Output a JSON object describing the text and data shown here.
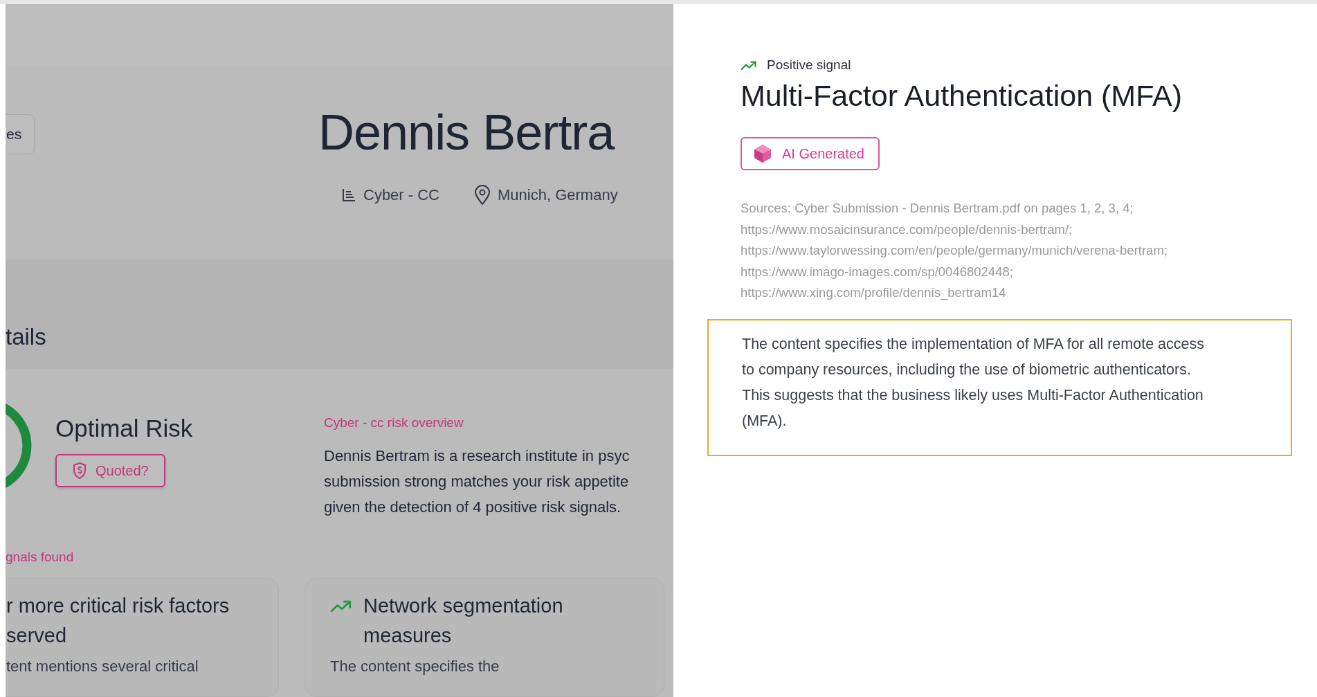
{
  "backdrop": {
    "header_button": "es",
    "profile": {
      "name": "Dennis Bertra",
      "line_of_business": "Cyber - CC",
      "location": "Munich, Germany"
    },
    "section_title": "tails",
    "risk": {
      "label": "Optimal Risk",
      "quote_button": "Quoted?"
    },
    "overview": {
      "title": "Cyber - cc risk overview",
      "lines": [
        "Dennis Bertram is a research institute in psyc",
        "submission strong matches your risk appetite",
        "given the detection of 4 positive risk signals."
      ]
    },
    "signals_label": "gnals found",
    "signal_cards": [
      {
        "kind": "neutral",
        "title_lines": [
          "r more critical risk factors",
          "served"
        ],
        "description": "tent mentions several critical"
      },
      {
        "kind": "positive",
        "title_lines": [
          "Network segmentation",
          "measures"
        ],
        "description": "The content specifies the"
      }
    ]
  },
  "detail_panel": {
    "signal_type": "Positive signal",
    "title": "Multi-Factor Authentication (MFA)",
    "badge": "AI Generated",
    "sources": [
      "Sources: Cyber Submission - Dennis Bertram.pdf on pages 1, 2, 3, 4;",
      "https://www.mosaicinsurance.com/people/dennis-bertram/;",
      "https://www.taylorwessing.com/en/people/germany/munich/verena-bertram;",
      "https://www.imago-images.com/sp/0046802448;",
      "https://www.xing.com/profile/dennis_bertram14"
    ],
    "description_lines": [
      "The content specifies the implementation of MFA for all remote access",
      "to company resources, including the use of biometric authenticators.",
      "This suggests that the business likely uses Multi-Factor Authentication",
      "(MFA)."
    ],
    "highlighted": true
  }
}
